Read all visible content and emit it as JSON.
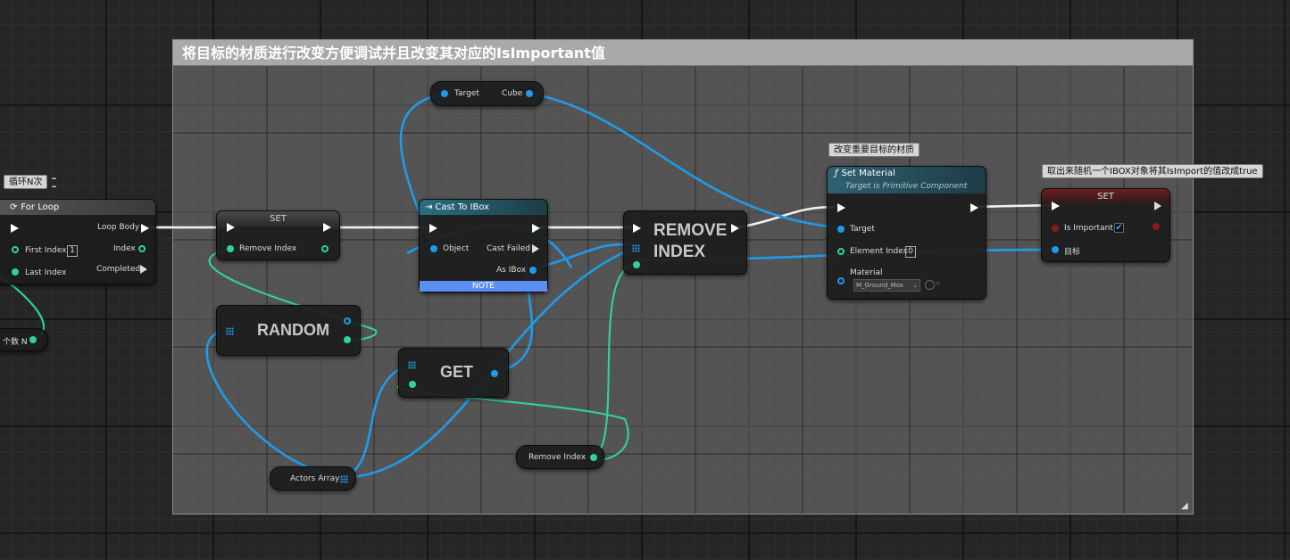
{
  "comment": {
    "title": "将目标的材质进行改变方便调试并且改变其对应的IsImportant值"
  },
  "bubbles": {
    "loop": "循环N次",
    "set_material": "改变重要目标的材质",
    "set_important": "取出来随机一个IBOX对象将其IsImport的值改成true"
  },
  "for_loop": {
    "title": "For Loop",
    "loop_body": "Loop Body",
    "first_index": "First Index",
    "first_index_value": "1",
    "index": "Index",
    "last_index": "Last Index",
    "completed": "Completed"
  },
  "count_node": {
    "label": "个数 N"
  },
  "set_node": {
    "title": "SET",
    "remove_index": "Remove Index"
  },
  "cast_node": {
    "title": "Cast To IBox",
    "object": "Object",
    "cast_failed": "Cast Failed",
    "as_ibox": "As IBox",
    "note": "NOTE"
  },
  "cube_node": {
    "target": "Target",
    "cube": "Cube"
  },
  "random_node": {
    "label": "RANDOM"
  },
  "get_node": {
    "label": "GET"
  },
  "remove_node": {
    "line1": "REMOVE",
    "line2": "INDEX"
  },
  "actors_node": {
    "label": "Actors Array"
  },
  "remove_index_var": {
    "label": "Remove Index"
  },
  "set_material": {
    "title": "Set Material",
    "subtitle": "Target is Primitive Component",
    "target": "Target",
    "element_index": "Element Index",
    "element_index_value": "0",
    "material": "Material",
    "material_value": "M_Ground_Mos"
  },
  "set_important": {
    "title": "SET",
    "is_important": "Is Important",
    "target": "目标",
    "is_important_checked": true
  },
  "colors": {
    "exec": "#ffffff",
    "object": "#1e9bea",
    "integer": "#2fd29a",
    "bool": "#8b1a1a",
    "cast_header": "#1d5060",
    "note_bar": "#5b8ff2"
  }
}
